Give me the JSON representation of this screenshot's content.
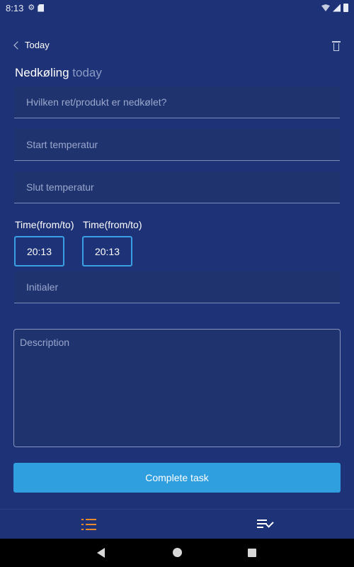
{
  "status_bar": {
    "time": "8:13"
  },
  "header": {
    "back_label": "Today"
  },
  "page": {
    "title": "Nedkøling",
    "subtitle": "today"
  },
  "form": {
    "product_placeholder": "Hvilken ret/produkt er nedkølet?",
    "start_temp_placeholder": "Start temperatur",
    "end_temp_placeholder": "Slut temperatur",
    "time_from_label": "Time(from/to)",
    "time_to_label": "Time(from/to)",
    "time_from_value": "20:13",
    "time_to_value": "20:13",
    "initials_placeholder": "Initialer",
    "description_placeholder": "Description"
  },
  "actions": {
    "complete_label": "Complete task"
  },
  "colors": {
    "background": "#1e3377",
    "accent": "#2f9fe0",
    "active_tab": "#e98a2c"
  }
}
